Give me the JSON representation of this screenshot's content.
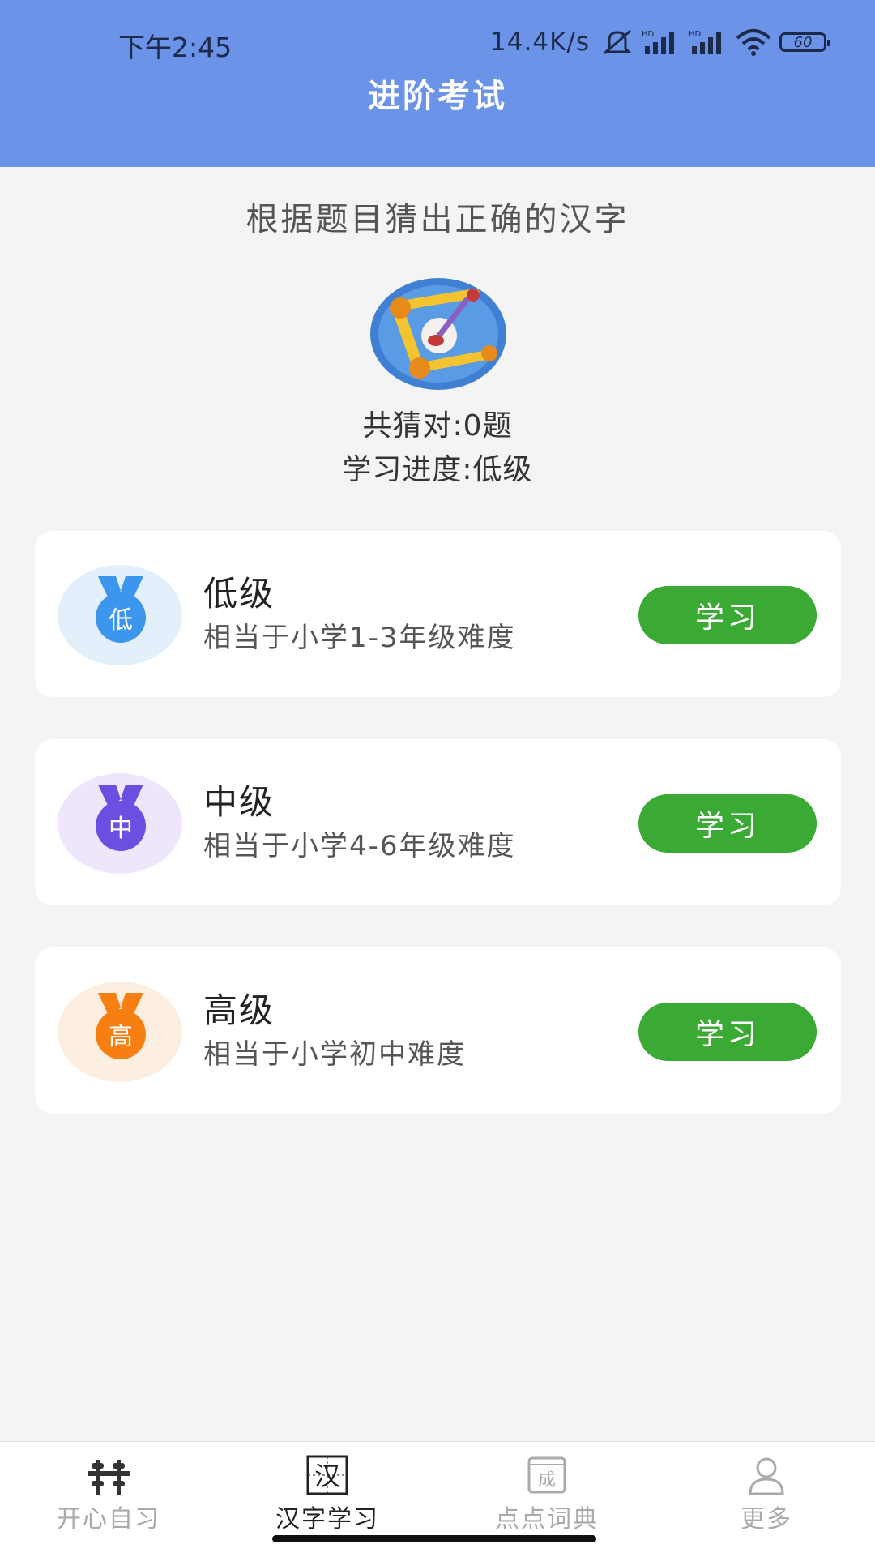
{
  "status_bar": {
    "time": "下午2:45",
    "net_speed": "14.4K/s",
    "signal_1_tag": "HD",
    "signal_2_tag": "HD",
    "battery": "60",
    "icons": [
      "mute-icon",
      "signal-icon",
      "signal-icon",
      "wifi-icon",
      "battery-icon"
    ]
  },
  "header": {
    "title": "进阶考试",
    "bg_color": "#6b93e8"
  },
  "summary": {
    "instruction": "根据题目猜出正确的汉字",
    "hero_icon": "scroll-brush-icon",
    "correct_count": "共猜对:0题",
    "progress": "学习进度:低级"
  },
  "levels": [
    {
      "badge": "低",
      "title": "低级",
      "description": "相当于小学1-3年级难度",
      "button": "学习",
      "color": "#3d96ee",
      "tint": "#e3f0fc",
      "icon": "medal-icon"
    },
    {
      "badge": "中",
      "title": "中级",
      "description": "相当于小学4-6年级难度",
      "button": "学习",
      "color": "#6a4fe0",
      "tint": "#efe6fb",
      "icon": "medal-icon"
    },
    {
      "badge": "高",
      "title": "高级",
      "description": "相当于小学初中难度",
      "button": "学习",
      "color": "#f77f12",
      "tint": "#fdeee2",
      "icon": "medal-icon"
    }
  ],
  "accent": {
    "button_green": "#3aaa35"
  },
  "bottom_nav": {
    "active_color": "#222222",
    "inactive_color": "#aaaaaa",
    "items": [
      {
        "label": "开心自习",
        "icon": "abacus-icon",
        "active": false
      },
      {
        "label": "汉字学习",
        "icon": "hanzi-icon",
        "icon_text": "汉",
        "active": true
      },
      {
        "label": "点点词典",
        "icon": "dictionary-icon",
        "icon_text": "成",
        "active": false
      },
      {
        "label": "更多",
        "icon": "user-icon",
        "active": false
      }
    ]
  }
}
